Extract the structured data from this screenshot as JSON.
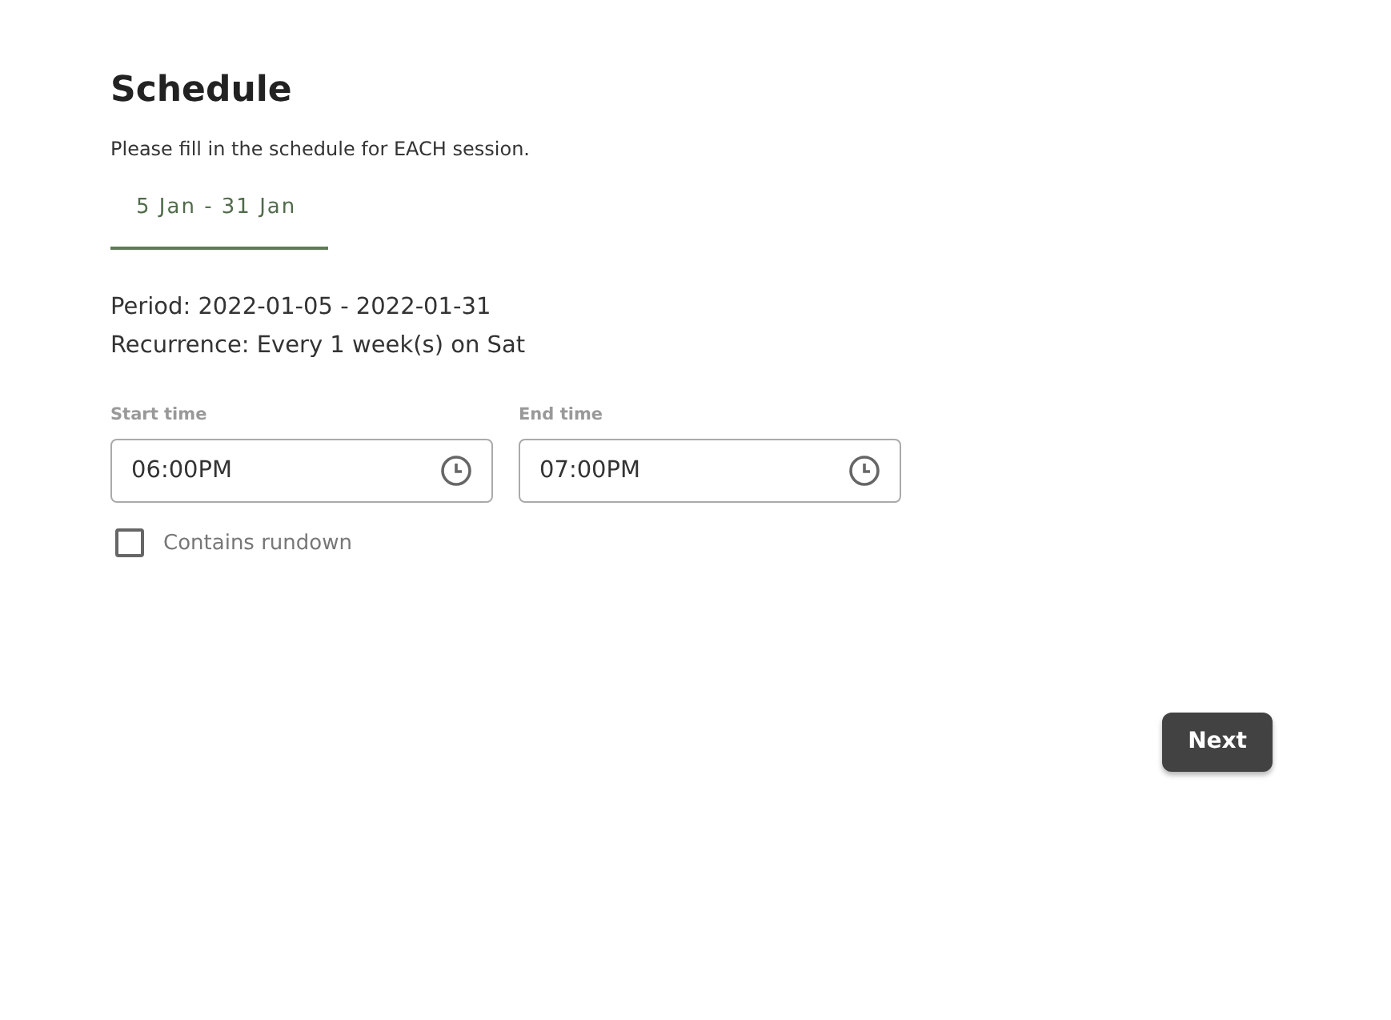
{
  "title": "Schedule",
  "instruction": "Please fill in the schedule for EACH session.",
  "tabs": [
    {
      "label": "5 Jan - 31 Jan",
      "selected": true
    }
  ],
  "period": "Period: 2022-01-05 - 2022-01-31",
  "recurrence": "Recurrence: Every 1 week(s) on Sat",
  "fields": [
    {
      "label": "Start time",
      "value": "06:00PM"
    },
    {
      "label": "End time",
      "value": "07:00PM"
    }
  ],
  "checkbox": {
    "label": "Contains rundown",
    "checked": false
  },
  "buttons": [
    {
      "label": "Next"
    }
  ]
}
